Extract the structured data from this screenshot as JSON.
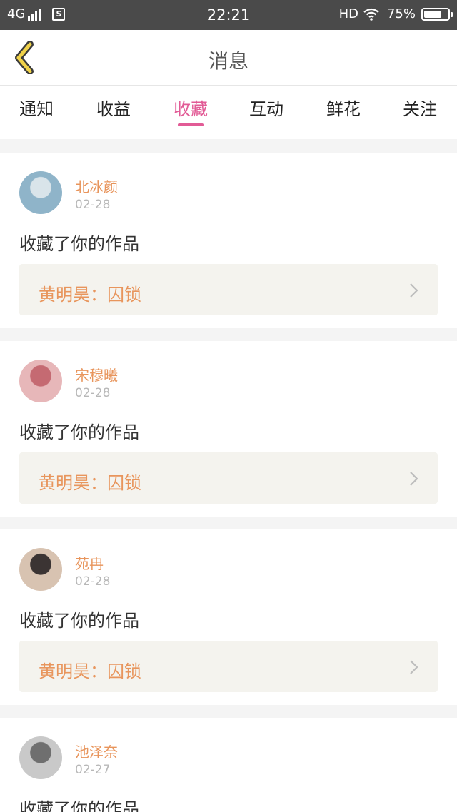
{
  "status_bar": {
    "network": "4G",
    "sim_label": "S",
    "time": "22:21",
    "hd_label": "HD",
    "battery_percent": "75%",
    "battery_level": 0.75
  },
  "header": {
    "title": "消息"
  },
  "tabs": [
    {
      "label": "通知"
    },
    {
      "label": "收益"
    },
    {
      "label": "收藏",
      "active": true
    },
    {
      "label": "互动"
    },
    {
      "label": "鲜花"
    },
    {
      "label": "关注"
    }
  ],
  "messages": [
    {
      "user": "北冰颜",
      "date": "02-28",
      "action": "收藏了你的作品",
      "work": "黄明昊：囚锁",
      "avatar_colors": [
        "#8fb4c9",
        "#d9e4ea"
      ]
    },
    {
      "user": "宋穆曦",
      "date": "02-28",
      "action": "收藏了你的作品",
      "work": "黄明昊：囚锁",
      "avatar_colors": [
        "#e7b7b9",
        "#c56a72"
      ]
    },
    {
      "user": "苑冉",
      "date": "02-28",
      "action": "收藏了你的作品",
      "work": "黄明昊：囚锁",
      "avatar_colors": [
        "#d8c3b1",
        "#3b3433"
      ]
    },
    {
      "user": "池泽奈",
      "date": "02-27",
      "action": "收藏了你的作品",
      "work": "",
      "avatar_colors": [
        "#c9c9c9",
        "#6f6f6f"
      ]
    }
  ],
  "colors": {
    "accent_pink": "#e25b96",
    "name_orange": "#e8955c",
    "back_arrow_yellow": "#f0d24a"
  }
}
